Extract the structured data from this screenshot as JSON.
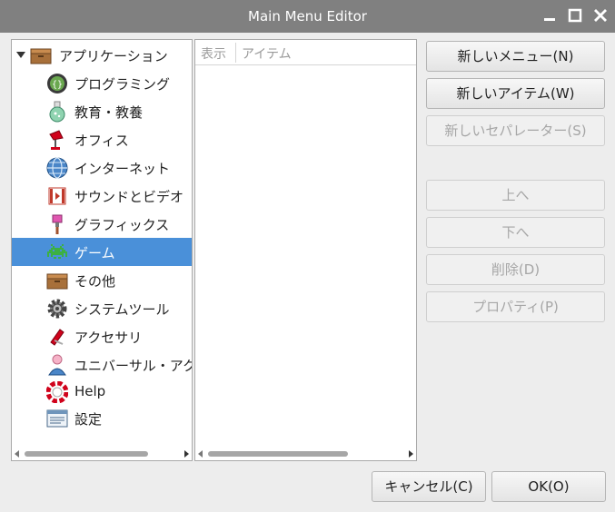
{
  "window": {
    "title": "Main Menu Editor"
  },
  "tree": {
    "root_label": "アプリケーション",
    "items": [
      {
        "label": "プログラミング",
        "icon": "programming-icon"
      },
      {
        "label": "教育・教養",
        "icon": "education-icon"
      },
      {
        "label": "オフィス",
        "icon": "office-icon"
      },
      {
        "label": "インターネット",
        "icon": "internet-icon"
      },
      {
        "label": "サウンドとビデオ",
        "icon": "sound-video-icon"
      },
      {
        "label": "グラフィックス",
        "icon": "graphics-icon"
      },
      {
        "label": "ゲーム",
        "icon": "games-icon"
      },
      {
        "label": "その他",
        "icon": "other-icon"
      },
      {
        "label": "システムツール",
        "icon": "system-tools-icon"
      },
      {
        "label": "アクセサリ",
        "icon": "accessories-icon"
      },
      {
        "label": "ユニバーサル・アクセス",
        "icon": "universal-access-icon"
      },
      {
        "label": "Help",
        "icon": "help-icon"
      },
      {
        "label": "設定",
        "icon": "settings-icon"
      }
    ],
    "selected_index": 6
  },
  "items_list": {
    "columns": [
      "表示",
      "アイテム"
    ]
  },
  "buttons": {
    "new_menu": "新しいメニュー(N)",
    "new_item": "新しいアイテム(W)",
    "new_separator": "新しいセパレーター(S)",
    "move_up": "上へ",
    "move_down": "下へ",
    "delete": "削除(D)",
    "properties": "プロパティ(P)",
    "cancel": "キャンセル(C)",
    "ok": "OK(O)"
  },
  "colors": {
    "titlebar": "#808080",
    "selection": "#4a90d9"
  }
}
